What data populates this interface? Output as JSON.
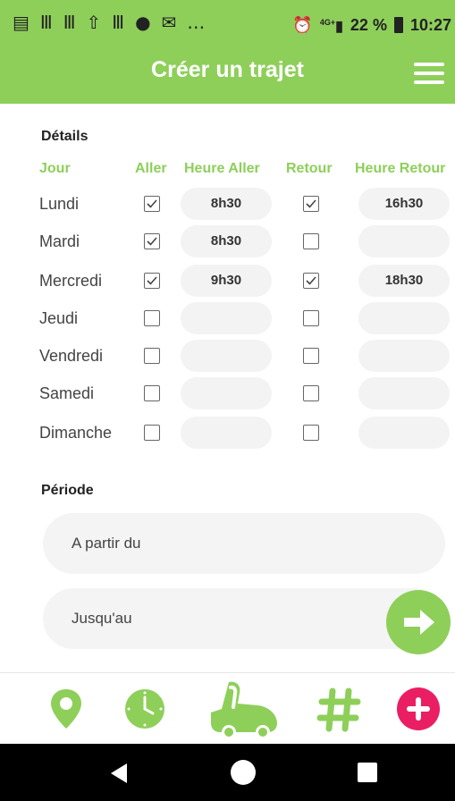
{
  "status_bar": {
    "network": "4G+",
    "battery": "22 %",
    "time": "10:27"
  },
  "header": {
    "title": "Créer un trajet",
    "menu_icon": "hamburger-menu-icon"
  },
  "details": {
    "title": "Détails",
    "columns": {
      "day": "Jour",
      "outbound": "Aller",
      "outbound_time": "Heure Aller",
      "return": "Retour",
      "return_time": "Heure Retour"
    },
    "rows": [
      {
        "day": "Lundi",
        "outbound_checked": true,
        "outbound_time": "8h30",
        "return_checked": true,
        "return_time": "16h30"
      },
      {
        "day": "Mardi",
        "outbound_checked": true,
        "outbound_time": "8h30",
        "return_checked": false,
        "return_time": ""
      },
      {
        "day": "Mercredi",
        "outbound_checked": true,
        "outbound_time": "9h30",
        "return_checked": true,
        "return_time": "18h30"
      },
      {
        "day": "Jeudi",
        "outbound_checked": false,
        "outbound_time": "",
        "return_checked": false,
        "return_time": ""
      },
      {
        "day": "Vendredi",
        "outbound_checked": false,
        "outbound_time": "",
        "return_checked": false,
        "return_time": ""
      },
      {
        "day": "Samedi",
        "outbound_checked": false,
        "outbound_time": "",
        "return_checked": false,
        "return_time": ""
      },
      {
        "day": "Dimanche",
        "outbound_checked": false,
        "outbound_time": "",
        "return_checked": false,
        "return_time": ""
      }
    ]
  },
  "period": {
    "title": "Période",
    "from_placeholder": "A partir du",
    "until_placeholder": "Jusqu'au",
    "next_icon": "arrow-right-icon"
  },
  "bottom_nav": [
    {
      "icon": "location-pin-icon",
      "color": "#8ecf5a"
    },
    {
      "icon": "clock-icon",
      "color": "#8ecf5a"
    },
    {
      "icon": "hitchhike-thumb-icon",
      "color": "#8ecf5a"
    },
    {
      "icon": "hashtag-icon",
      "color": "#8ecf5a"
    },
    {
      "icon": "plus-circle-icon",
      "color": "#ea1e63"
    }
  ],
  "system_nav": [
    "back-icon",
    "home-icon",
    "recents-icon"
  ],
  "colors": {
    "primary": "#8ecf5a",
    "accent": "#ea1e63",
    "field_bg": "#f3f3f3"
  }
}
